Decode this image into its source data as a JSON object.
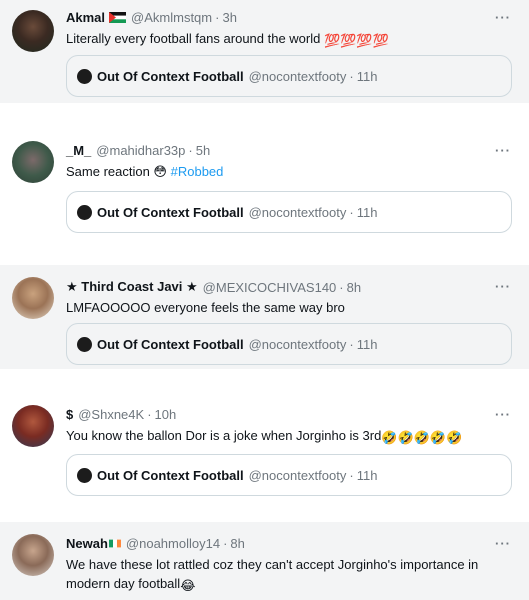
{
  "tweets": [
    {
      "name": "Akmal",
      "handle": "@Akmlmstqm",
      "time": "3h",
      "text": "Literally every football fans around the world ",
      "emoji": "💯💯💯💯",
      "quote": {
        "name": "Out Of Context Football",
        "handle": "@nocontextfooty",
        "time": "11h"
      }
    },
    {
      "name": "_M_",
      "handle": "@mahidhar33p",
      "time": "5h",
      "text": "Same reaction 😳 ",
      "hashtag": "#Robbed",
      "quote": {
        "name": "Out Of Context Football",
        "handle": "@nocontextfooty",
        "time": "11h"
      }
    },
    {
      "name": "★ Third Coast Javi ★",
      "handle": "@MEXICOCHIVAS140",
      "time": "8h",
      "text": "LMFAOOOOO everyone feels the same way bro",
      "quote": {
        "name": "Out Of Context Football",
        "handle": "@nocontextfooty",
        "time": "11h"
      }
    },
    {
      "name": "$",
      "handle": "@Shxne4K",
      "time": "10h",
      "text": "You know the ballon Dor is a joke when Jorginho is 3rd",
      "emoji": "🤣🤣🤣🤣🤣",
      "quote": {
        "name": "Out Of Context Football",
        "handle": "@nocontextfooty",
        "time": "11h"
      }
    },
    {
      "name": "Newah",
      "handle": "@noahmolloy14",
      "time": "8h",
      "text": "We have these lot rattled coz they can't accept Jorginho's importance in modern day football",
      "emoji": "😂"
    }
  ],
  "ui": {
    "separator_dot": "·",
    "more_label": "···"
  },
  "colors": {
    "accent": "#1d9bf0",
    "muted": "#6e767d",
    "border": "#cfd9de",
    "card_grey": "#f3f4f5"
  },
  "icons": [
    "palestine-flag-icon",
    "ireland-flag-icon",
    "more-icon"
  ]
}
